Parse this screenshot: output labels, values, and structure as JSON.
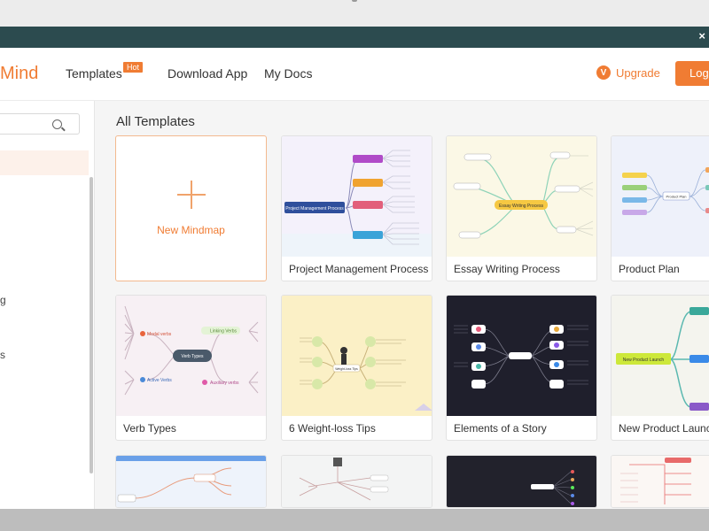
{
  "app": {
    "logo_text": "Mind",
    "window_close_glyph": "×"
  },
  "nav": {
    "templates": "Templates",
    "hot_badge": "Hot",
    "download_app": "Download App",
    "my_docs": "My Docs",
    "upgrade": "Upgrade",
    "login": "Login"
  },
  "sidebar": {
    "fragments": [
      "g",
      "s"
    ]
  },
  "main": {
    "section_title": "All Templates",
    "new_mindmap": "New Mindmap",
    "cards": [
      {
        "label": "Project Management Process"
      },
      {
        "label": "Essay Writing Process"
      },
      {
        "label": "Product Plan"
      },
      {
        "label": "Verb Types"
      },
      {
        "label": "6 Weight-loss Tips"
      },
      {
        "label": "Elements of a Story"
      },
      {
        "label": "New Product Launch"
      }
    ]
  },
  "thumb_text": {
    "pm_root": "Project Management Process",
    "essay_root": "Essay Writing Process",
    "product_root": "Product Plan",
    "verb_root": "Verb Types",
    "verb_modal": "Modal verbs",
    "verb_linking": "Linking Verbs",
    "verb_active": "Active Verbs",
    "verb_aux": "Auxiliary verbs",
    "launch_root": "New Product Launch",
    "weight_root": "Weight-loss Tips"
  },
  "colors": {
    "brand": "#f07c33",
    "titlebar": "#2c4b4f"
  }
}
